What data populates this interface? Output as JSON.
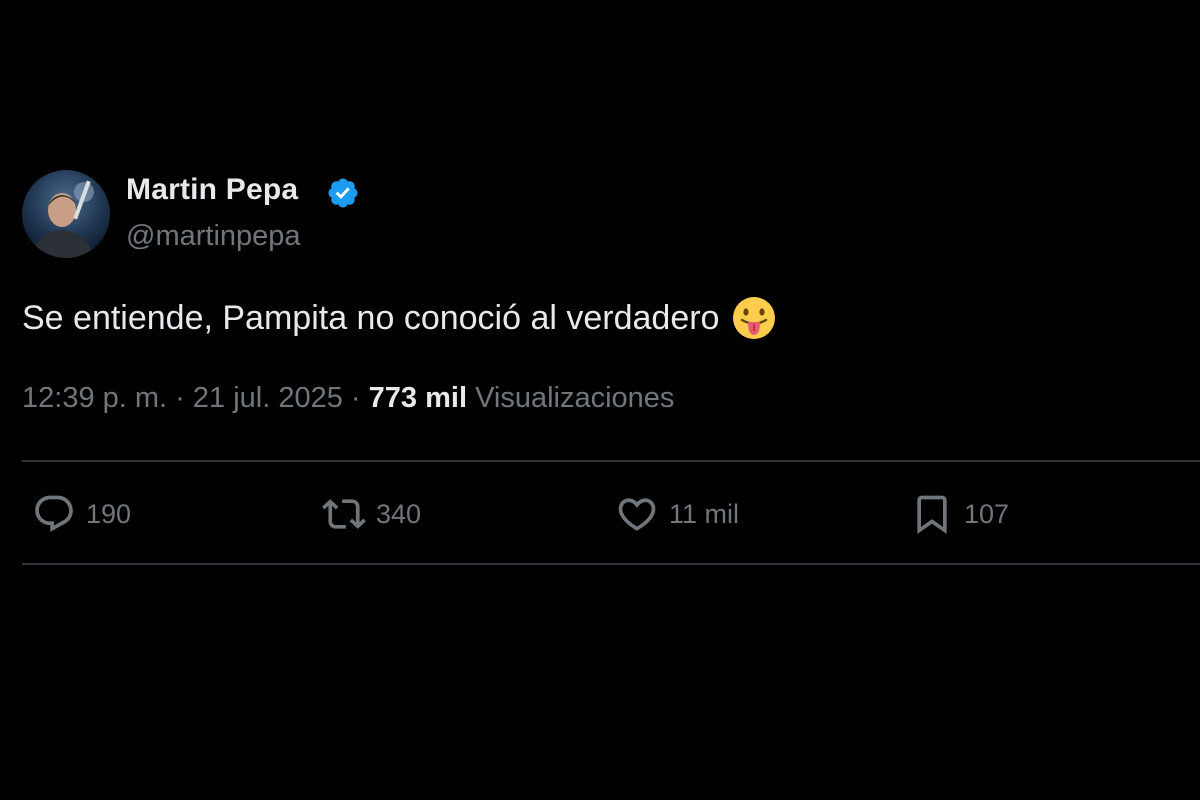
{
  "author": {
    "display_name": "Martin Pepa",
    "handle": "@martinpepa",
    "verified": true,
    "avatar_icon": "user-avatar"
  },
  "tweet": {
    "text": "Se entiende, Pampita no conoció al verdadero",
    "emoji": "face-with-tongue-emoji"
  },
  "meta": {
    "time": "12:39 p. m.",
    "separator": "·",
    "date": "21 jul. 2025",
    "views_count": "773 mil",
    "views_label": "Visualizaciones"
  },
  "actions": {
    "replies": "190",
    "retweets": "340",
    "likes": "11 mil",
    "bookmarks": "107"
  },
  "colors": {
    "background": "#000000",
    "primary_text": "#e7e9ea",
    "secondary_text": "#71767b",
    "verified_badge": "#1d9bf0",
    "divider": "#2f3336"
  }
}
